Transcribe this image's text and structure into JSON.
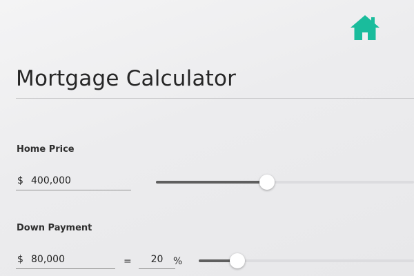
{
  "colors": {
    "accent": "#1abc9c",
    "text": "#262626",
    "slider_fill": "#5f5f5f",
    "slider_track": "#dcdcdf"
  },
  "header": {
    "home_icon": "home-icon",
    "title": "Mortgage Calculator"
  },
  "home_price": {
    "label": "Home Price",
    "currency": "$",
    "value": "400,000",
    "slider_fraction": 0.43
  },
  "down_payment": {
    "label": "Down Payment",
    "currency": "$",
    "amount": "80,000",
    "equals": "=",
    "percent": "20",
    "percent_sign": "%",
    "slider_fraction": 0.18
  }
}
